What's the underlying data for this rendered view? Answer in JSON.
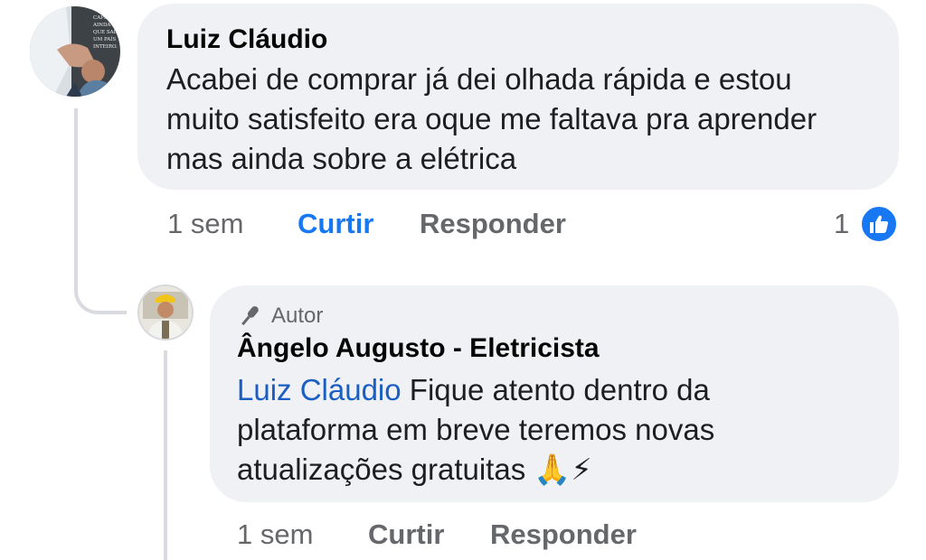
{
  "comment": {
    "author": "Luiz Cláudio",
    "text": "Acabei de comprar já dei olhada rápida e estou muito satisfeito era oque me faltava pra aprender mas ainda sobre a elétrica",
    "avatar_text": "CAPITÃO AINDA TE QUE SALVA UM PAÍS INTEIRO.",
    "time": "1 sem",
    "like_label": "Curtir",
    "reply_label": "Responder",
    "reaction_count": "1",
    "reaction_icon": "thumbs-up-icon"
  },
  "reply": {
    "badge_label": "Autor",
    "badge_icon": "microphone-icon",
    "author": "Ângelo Augusto - Eletricista",
    "mention": "Luiz Cláudio",
    "text": "Fique atento dentro da plataforma em breve teremos novas atualizações gratuitas",
    "emojis": "🙏⚡",
    "time": "1 sem",
    "like_label": "Curtir",
    "reply_label": "Responder"
  },
  "colors": {
    "bubble": "#eff1f4",
    "link": "#1877f2",
    "mention": "#1a5ec3",
    "muted": "#65676b"
  }
}
